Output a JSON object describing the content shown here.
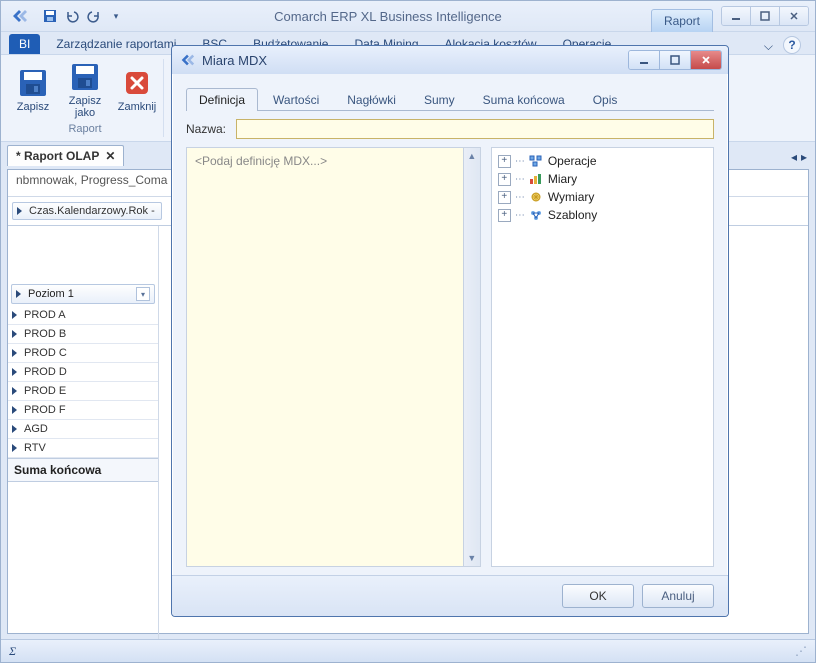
{
  "app": {
    "title": "Comarch ERP XL Business Intelligence",
    "context_tab": "Raport"
  },
  "ribbon": {
    "tabs": [
      "BI",
      "Zarządzanie raportami",
      "BSC",
      "Budżetowanie",
      "Data Mining",
      "Alokacja kosztów",
      "Operacje"
    ],
    "active": "BI",
    "group_label": "Raport",
    "buttons": {
      "save": "Zapisz",
      "save_as_l1": "Zapisz",
      "save_as_l2": "jako",
      "close": "Zamknij"
    }
  },
  "document": {
    "tab_title": "* Raport OLAP",
    "breadcrumb": "nbmnowak, Progress_Coma",
    "column_field": "Czas.Kalendarzowy.Rok -",
    "level_label": "Poziom 1",
    "rows": [
      "PROD A",
      "PROD B",
      "PROD C",
      "PROD D",
      "PROD E",
      "PROD F",
      "AGD",
      "RTV"
    ],
    "total_label": "Suma końcowa"
  },
  "statusbar": {
    "sigma": "Σ"
  },
  "dialog": {
    "title": "Miara MDX",
    "tabs": [
      "Definicja",
      "Wartości",
      "Nagłówki",
      "Sumy",
      "Suma końcowa",
      "Opis"
    ],
    "active_tab": "Definicja",
    "name_label": "Nazwa:",
    "name_value": "",
    "mdx_placeholder": "<Podaj definicję MDX...>",
    "tree": [
      "Operacje",
      "Miary",
      "Wymiary",
      "Szablony"
    ],
    "ok": "OK",
    "cancel": "Anuluj"
  }
}
